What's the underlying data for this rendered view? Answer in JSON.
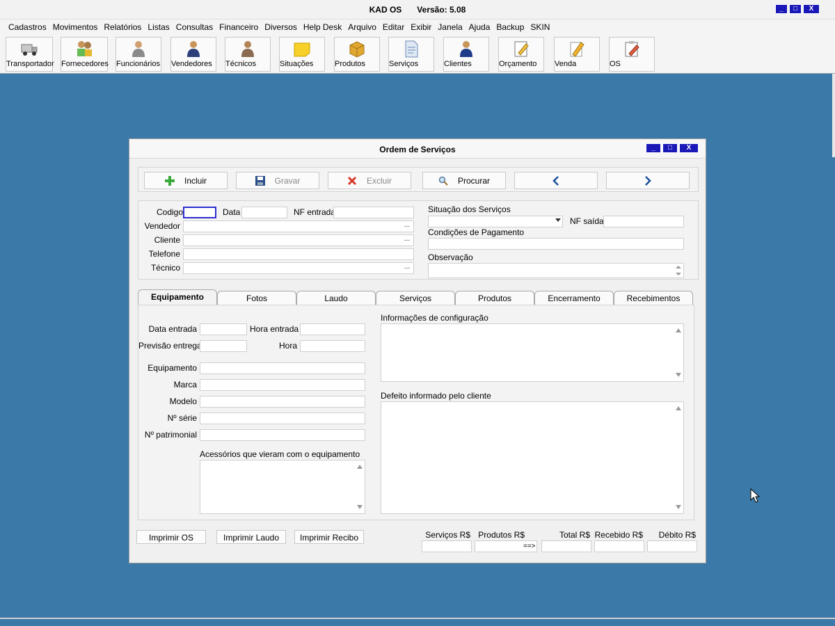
{
  "app": {
    "title": "KAD OS",
    "version": "Versão: 5.08"
  },
  "menu": [
    "Cadastros",
    "Movimentos",
    "Relatórios",
    "Listas",
    "Consultas",
    "Financeiro",
    "Diversos",
    "Help Desk",
    "Arquivo",
    "Editar",
    "Exibir",
    "Janela",
    "Ajuda",
    "Backup",
    "SKIN"
  ],
  "toolbar": {
    "transportador": "Transportador",
    "fornecedores": "Fornecedores",
    "funcionarios": "Funcionários",
    "vendedores": "Vendedores",
    "tecnicos": "Técnicos",
    "situacoes": "Situações",
    "produtos": "Produtos",
    "servicos": "Serviços",
    "clientes": "Clientes",
    "orcamento": "Orçamento",
    "venda": "Venda",
    "os": "OS"
  },
  "dialog": {
    "title": "Ordem de Serviços",
    "actions": {
      "incluir": "Incluir",
      "gravar": "Gravar",
      "excluir": "Excluir",
      "procurar": "Procurar"
    },
    "header": {
      "codigo": "Codigo",
      "data": "Data",
      "nf_entrada": "NF entrada",
      "vendedor": "Vendedor",
      "cliente": "Cliente",
      "telefone": "Telefone",
      "tecnico": "Técnico",
      "situacao": "Situação dos Serviços",
      "nf_saida": "NF saída",
      "condicoes": "Condições de Pagamento",
      "observacao": "Observação"
    },
    "tabs": [
      "Equipamento",
      "Fotos",
      "Laudo",
      "Serviços",
      "Produtos",
      "Encerramento",
      "Recebimentos"
    ],
    "equipamento": {
      "data_entrada": "Data entrada",
      "hora_entrada": "Hora entrada",
      "previsao": "Previsão entrega",
      "hora": "Hora",
      "equipamento": "Equipamento",
      "marca": "Marca",
      "modelo": "Modelo",
      "serie": "Nº série",
      "patrimonial": "Nº patrimonial",
      "acessorios": "Acessórios que vieram com o equipamento",
      "info_config": "Informações de configuração",
      "defeito": "Defeito informado pelo cliente"
    },
    "footer": {
      "imprimir_os": "Imprimir OS",
      "imprimir_laudo": "Imprimir Laudo",
      "imprimir_recibo": "Imprimir Recibo",
      "servicos": "Serviços R$",
      "produtos": "Produtos R$",
      "arrow": "==>",
      "total": "Total R$",
      "recebido": "Recebido R$",
      "debito": "Débito R$"
    }
  }
}
